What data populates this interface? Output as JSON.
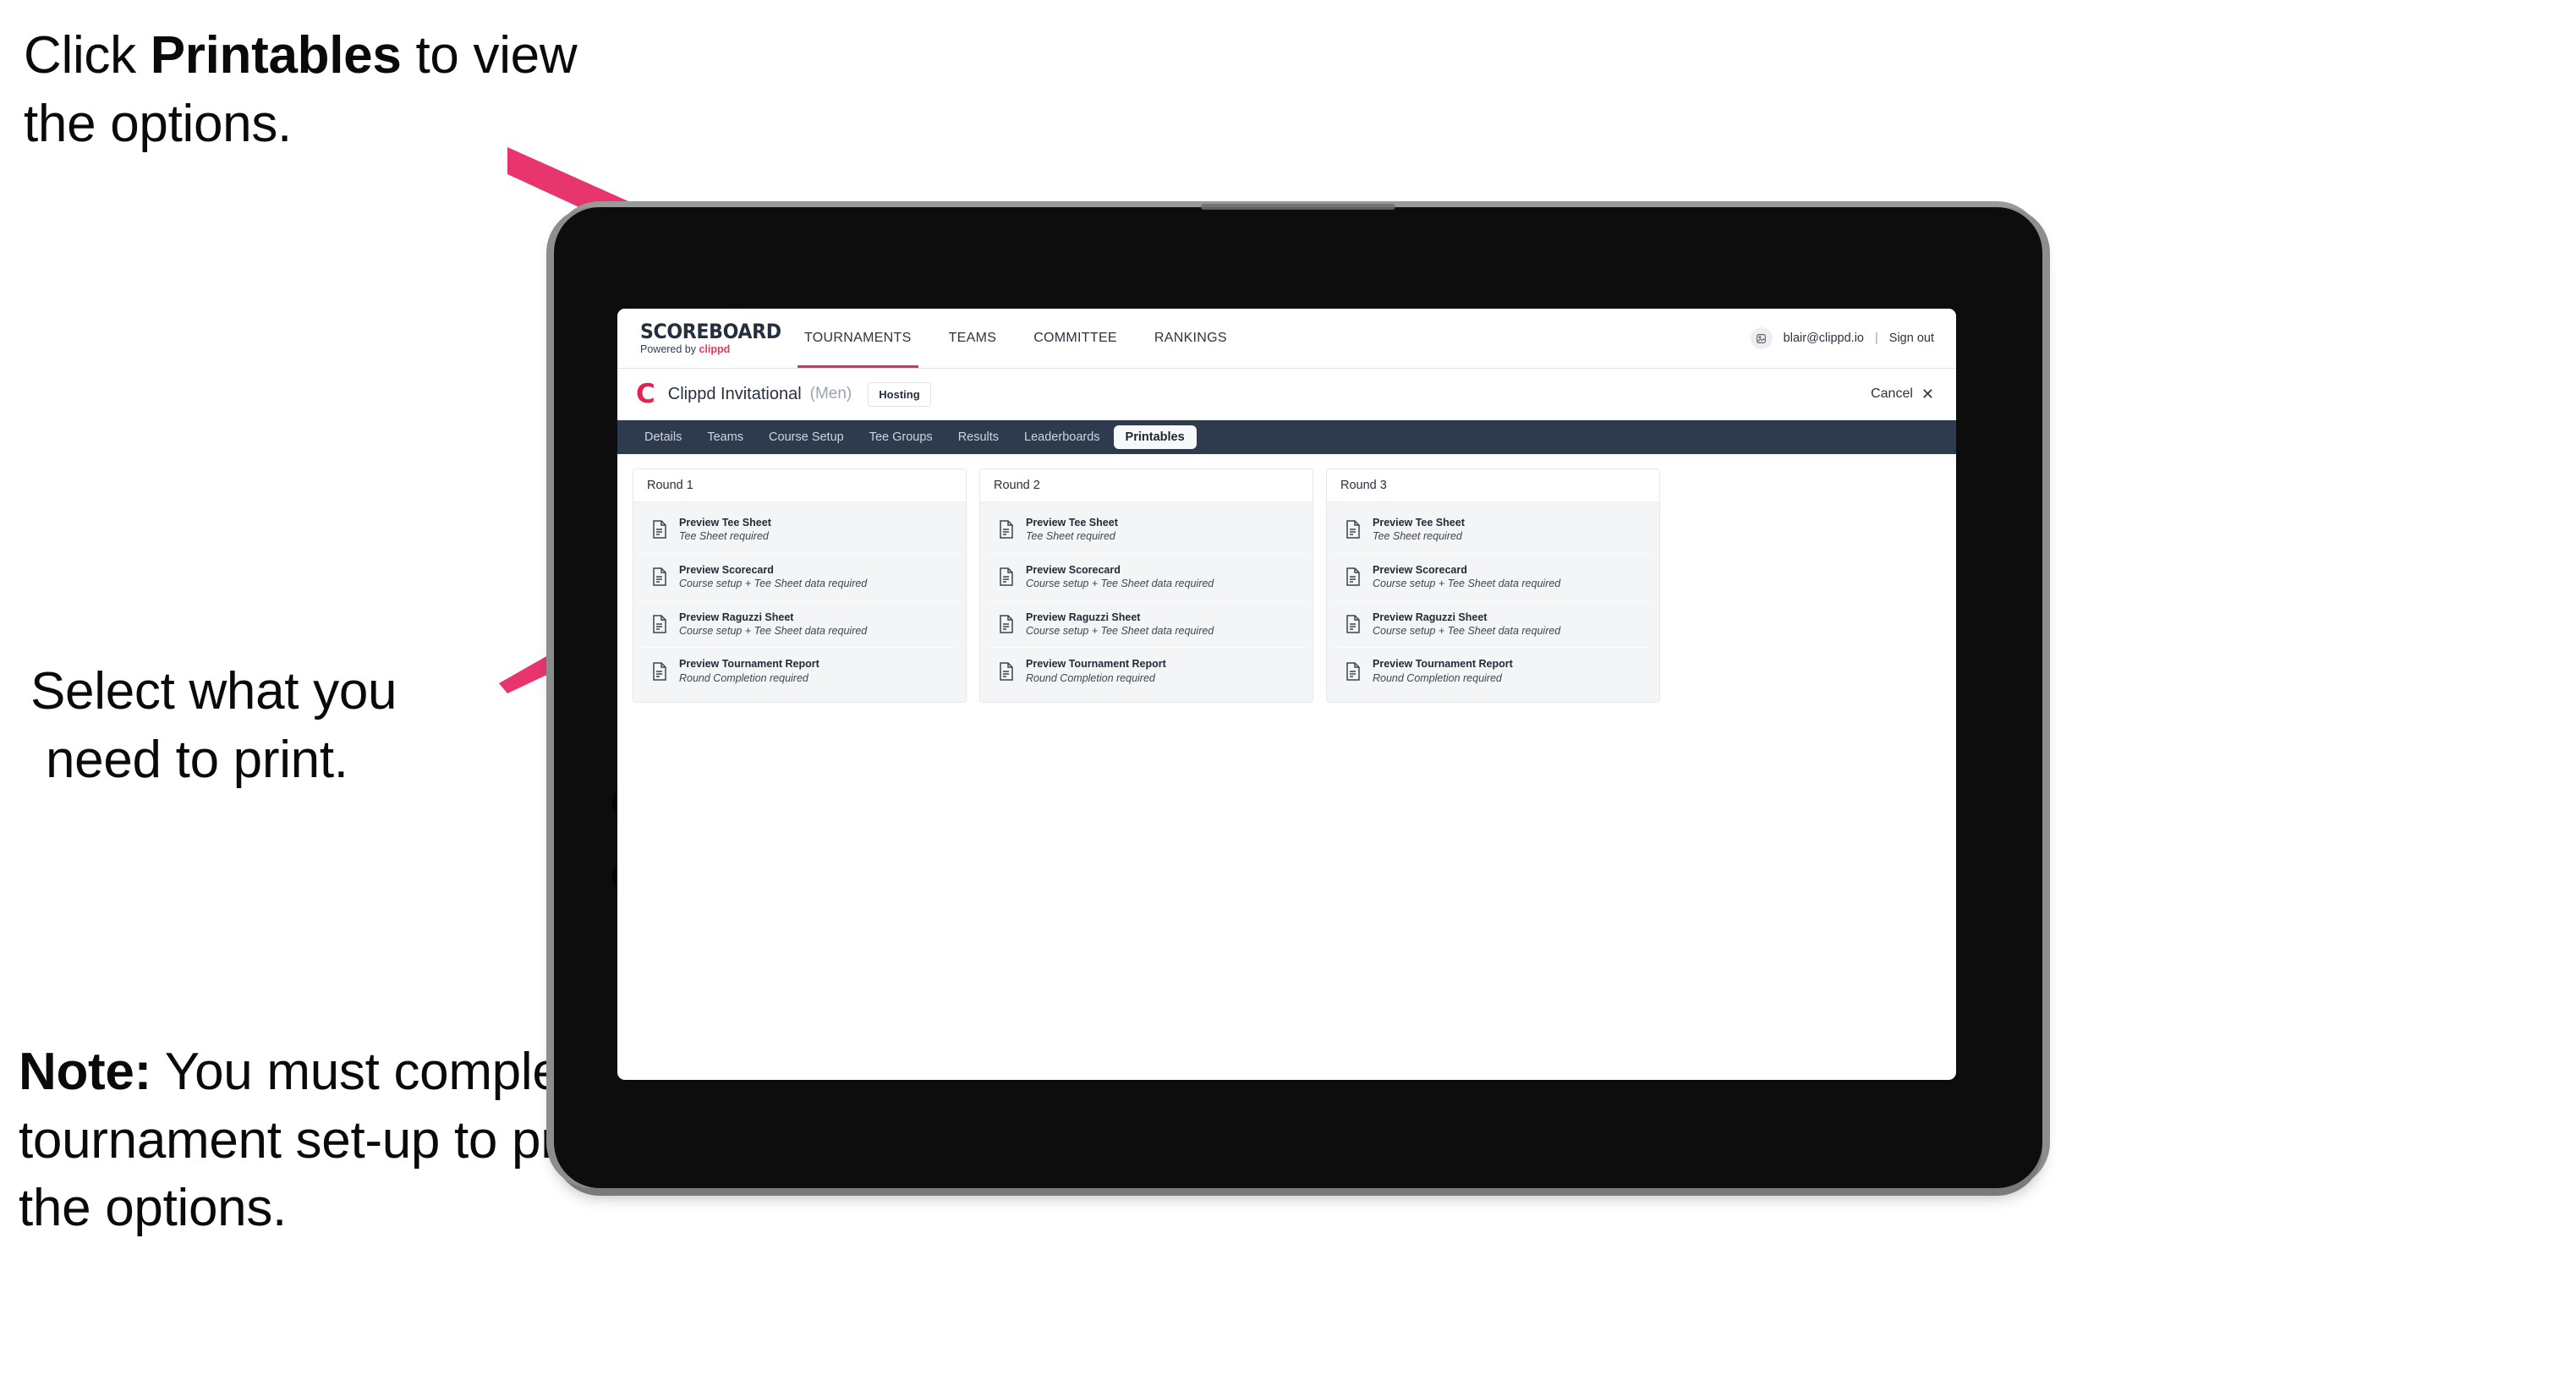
{
  "annotations": {
    "click_printables": {
      "pre": "Click ",
      "bold": "Printables",
      "post": " to view the options."
    },
    "select_print": {
      "line1": "Select what you",
      "line2": "need to print."
    },
    "note": {
      "bold": "Note:",
      "text": " You must complete the tournament set-up to print all the options."
    }
  },
  "colors": {
    "arrow": "#e8356d",
    "tab_strip": "#2e3a4d",
    "brand_accent": "#e23b63",
    "tournament_logo": "#e0244f"
  },
  "app": {
    "brand": {
      "title": "SCOREBOARD",
      "powered_prefix": "Powered by ",
      "powered_name": "clippd"
    },
    "top_nav": [
      {
        "label": "TOURNAMENTS",
        "active": true
      },
      {
        "label": "TEAMS",
        "active": false
      },
      {
        "label": "COMMITTEE",
        "active": false
      },
      {
        "label": "RANKINGS",
        "active": false
      }
    ],
    "account": {
      "avatar_icon": "user-avatar-icon",
      "email": "blair@clippd.io",
      "separator": "|",
      "sign_out": "Sign out"
    },
    "tournament": {
      "logo_letter": "C",
      "name": "Clippd Invitational",
      "gender": "(Men)",
      "status": "Hosting",
      "cancel_label": "Cancel",
      "cancel_icon": "close-icon"
    },
    "tabs": [
      {
        "label": "Details",
        "active": false
      },
      {
        "label": "Teams",
        "active": false
      },
      {
        "label": "Course Setup",
        "active": false
      },
      {
        "label": "Tee Groups",
        "active": false
      },
      {
        "label": "Results",
        "active": false
      },
      {
        "label": "Leaderboards",
        "active": false
      },
      {
        "label": "Printables",
        "active": true
      }
    ],
    "rounds": [
      {
        "title": "Round 1",
        "items": [
          {
            "title": "Preview Tee Sheet",
            "subtitle": "Tee Sheet required",
            "icon": "document-icon"
          },
          {
            "title": "Preview Scorecard",
            "subtitle": "Course setup + Tee Sheet data required",
            "icon": "document-icon"
          },
          {
            "title": "Preview Raguzzi Sheet",
            "subtitle": "Course setup + Tee Sheet data required",
            "icon": "document-icon"
          },
          {
            "title": "Preview Tournament Report",
            "subtitle": "Round Completion required",
            "icon": "document-icon"
          }
        ]
      },
      {
        "title": "Round 2",
        "items": [
          {
            "title": "Preview Tee Sheet",
            "subtitle": "Tee Sheet required",
            "icon": "document-icon"
          },
          {
            "title": "Preview Scorecard",
            "subtitle": "Course setup + Tee Sheet data required",
            "icon": "document-icon"
          },
          {
            "title": "Preview Raguzzi Sheet",
            "subtitle": "Course setup + Tee Sheet data required",
            "icon": "document-icon"
          },
          {
            "title": "Preview Tournament Report",
            "subtitle": "Round Completion required",
            "icon": "document-icon"
          }
        ]
      },
      {
        "title": "Round 3",
        "items": [
          {
            "title": "Preview Tee Sheet",
            "subtitle": "Tee Sheet required",
            "icon": "document-icon"
          },
          {
            "title": "Preview Scorecard",
            "subtitle": "Course setup + Tee Sheet data required",
            "icon": "document-icon"
          },
          {
            "title": "Preview Raguzzi Sheet",
            "subtitle": "Course setup + Tee Sheet data required",
            "icon": "document-icon"
          },
          {
            "title": "Preview Tournament Report",
            "subtitle": "Round Completion required",
            "icon": "document-icon"
          }
        ]
      }
    ]
  }
}
